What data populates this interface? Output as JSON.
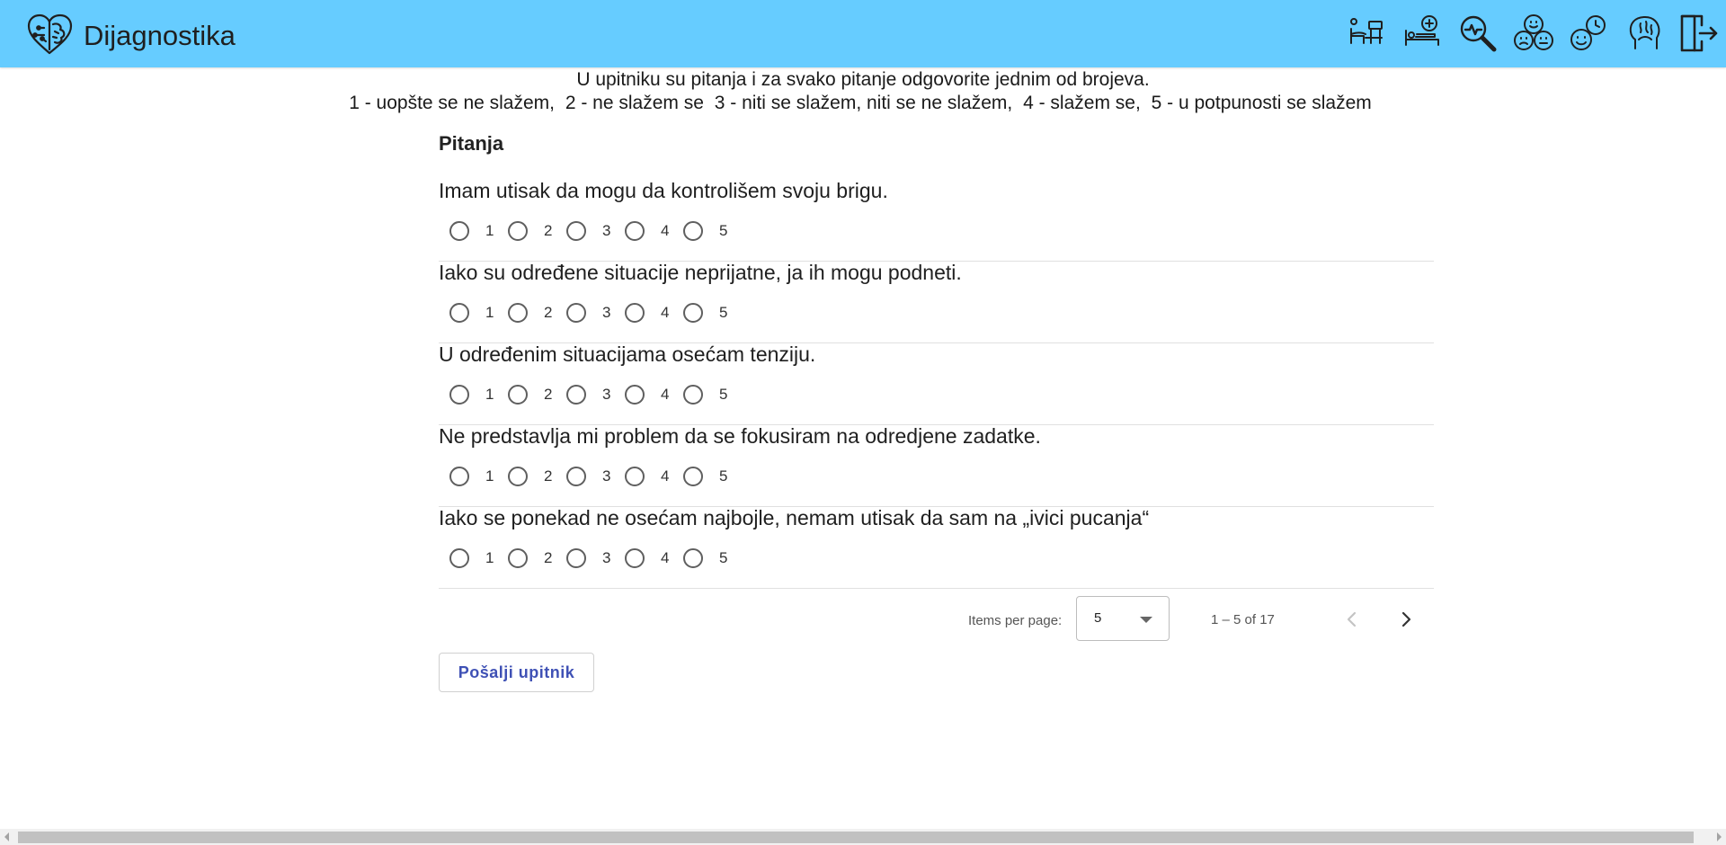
{
  "header": {
    "title": "Dijagnostika",
    "logo_icon": "brain-heart-icon",
    "nav_icons": [
      "therapy-couch-icon",
      "add-patient-bed-icon",
      "search-diagnosis-icon",
      "emotions-faces-icon",
      "mood-history-icon",
      "brain-hand-icon",
      "logout-icon"
    ]
  },
  "instructions": {
    "line1": "U upitniku su pitanja i za svako pitanje odgovorite jednim od brojeva.",
    "scale": [
      "1 - uopšte se ne slažem,",
      "2 - ne slažem se",
      "3 - niti se slažem, niti se ne slažem,",
      "4 - slažem se,",
      "5 - u potpunosti se slažem"
    ]
  },
  "section_title": "Pitanja",
  "options": [
    "1",
    "2",
    "3",
    "4",
    "5"
  ],
  "questions": [
    {
      "text": "Imam utisak da mogu da kontrolišem svoju brigu."
    },
    {
      "text": "Iako su određene situacije neprijatne, ja ih mogu podneti."
    },
    {
      "text": "U određenim situacijama osećam tenziju."
    },
    {
      "text": "Ne predstavlja mi problem da se fokusiram na odredjene zadatke."
    },
    {
      "text": "Iako se ponekad ne osećam najbojle, nemam utisak da sam na „ivici pucanja“"
    }
  ],
  "paginator": {
    "items_per_page_label": "Items per page:",
    "page_size": "5",
    "range_label": "1 – 5 of 17"
  },
  "submit_label": "Pošalji upitnik",
  "colors": {
    "header_bg": "#66ccff",
    "accent": "#3f51b5"
  }
}
